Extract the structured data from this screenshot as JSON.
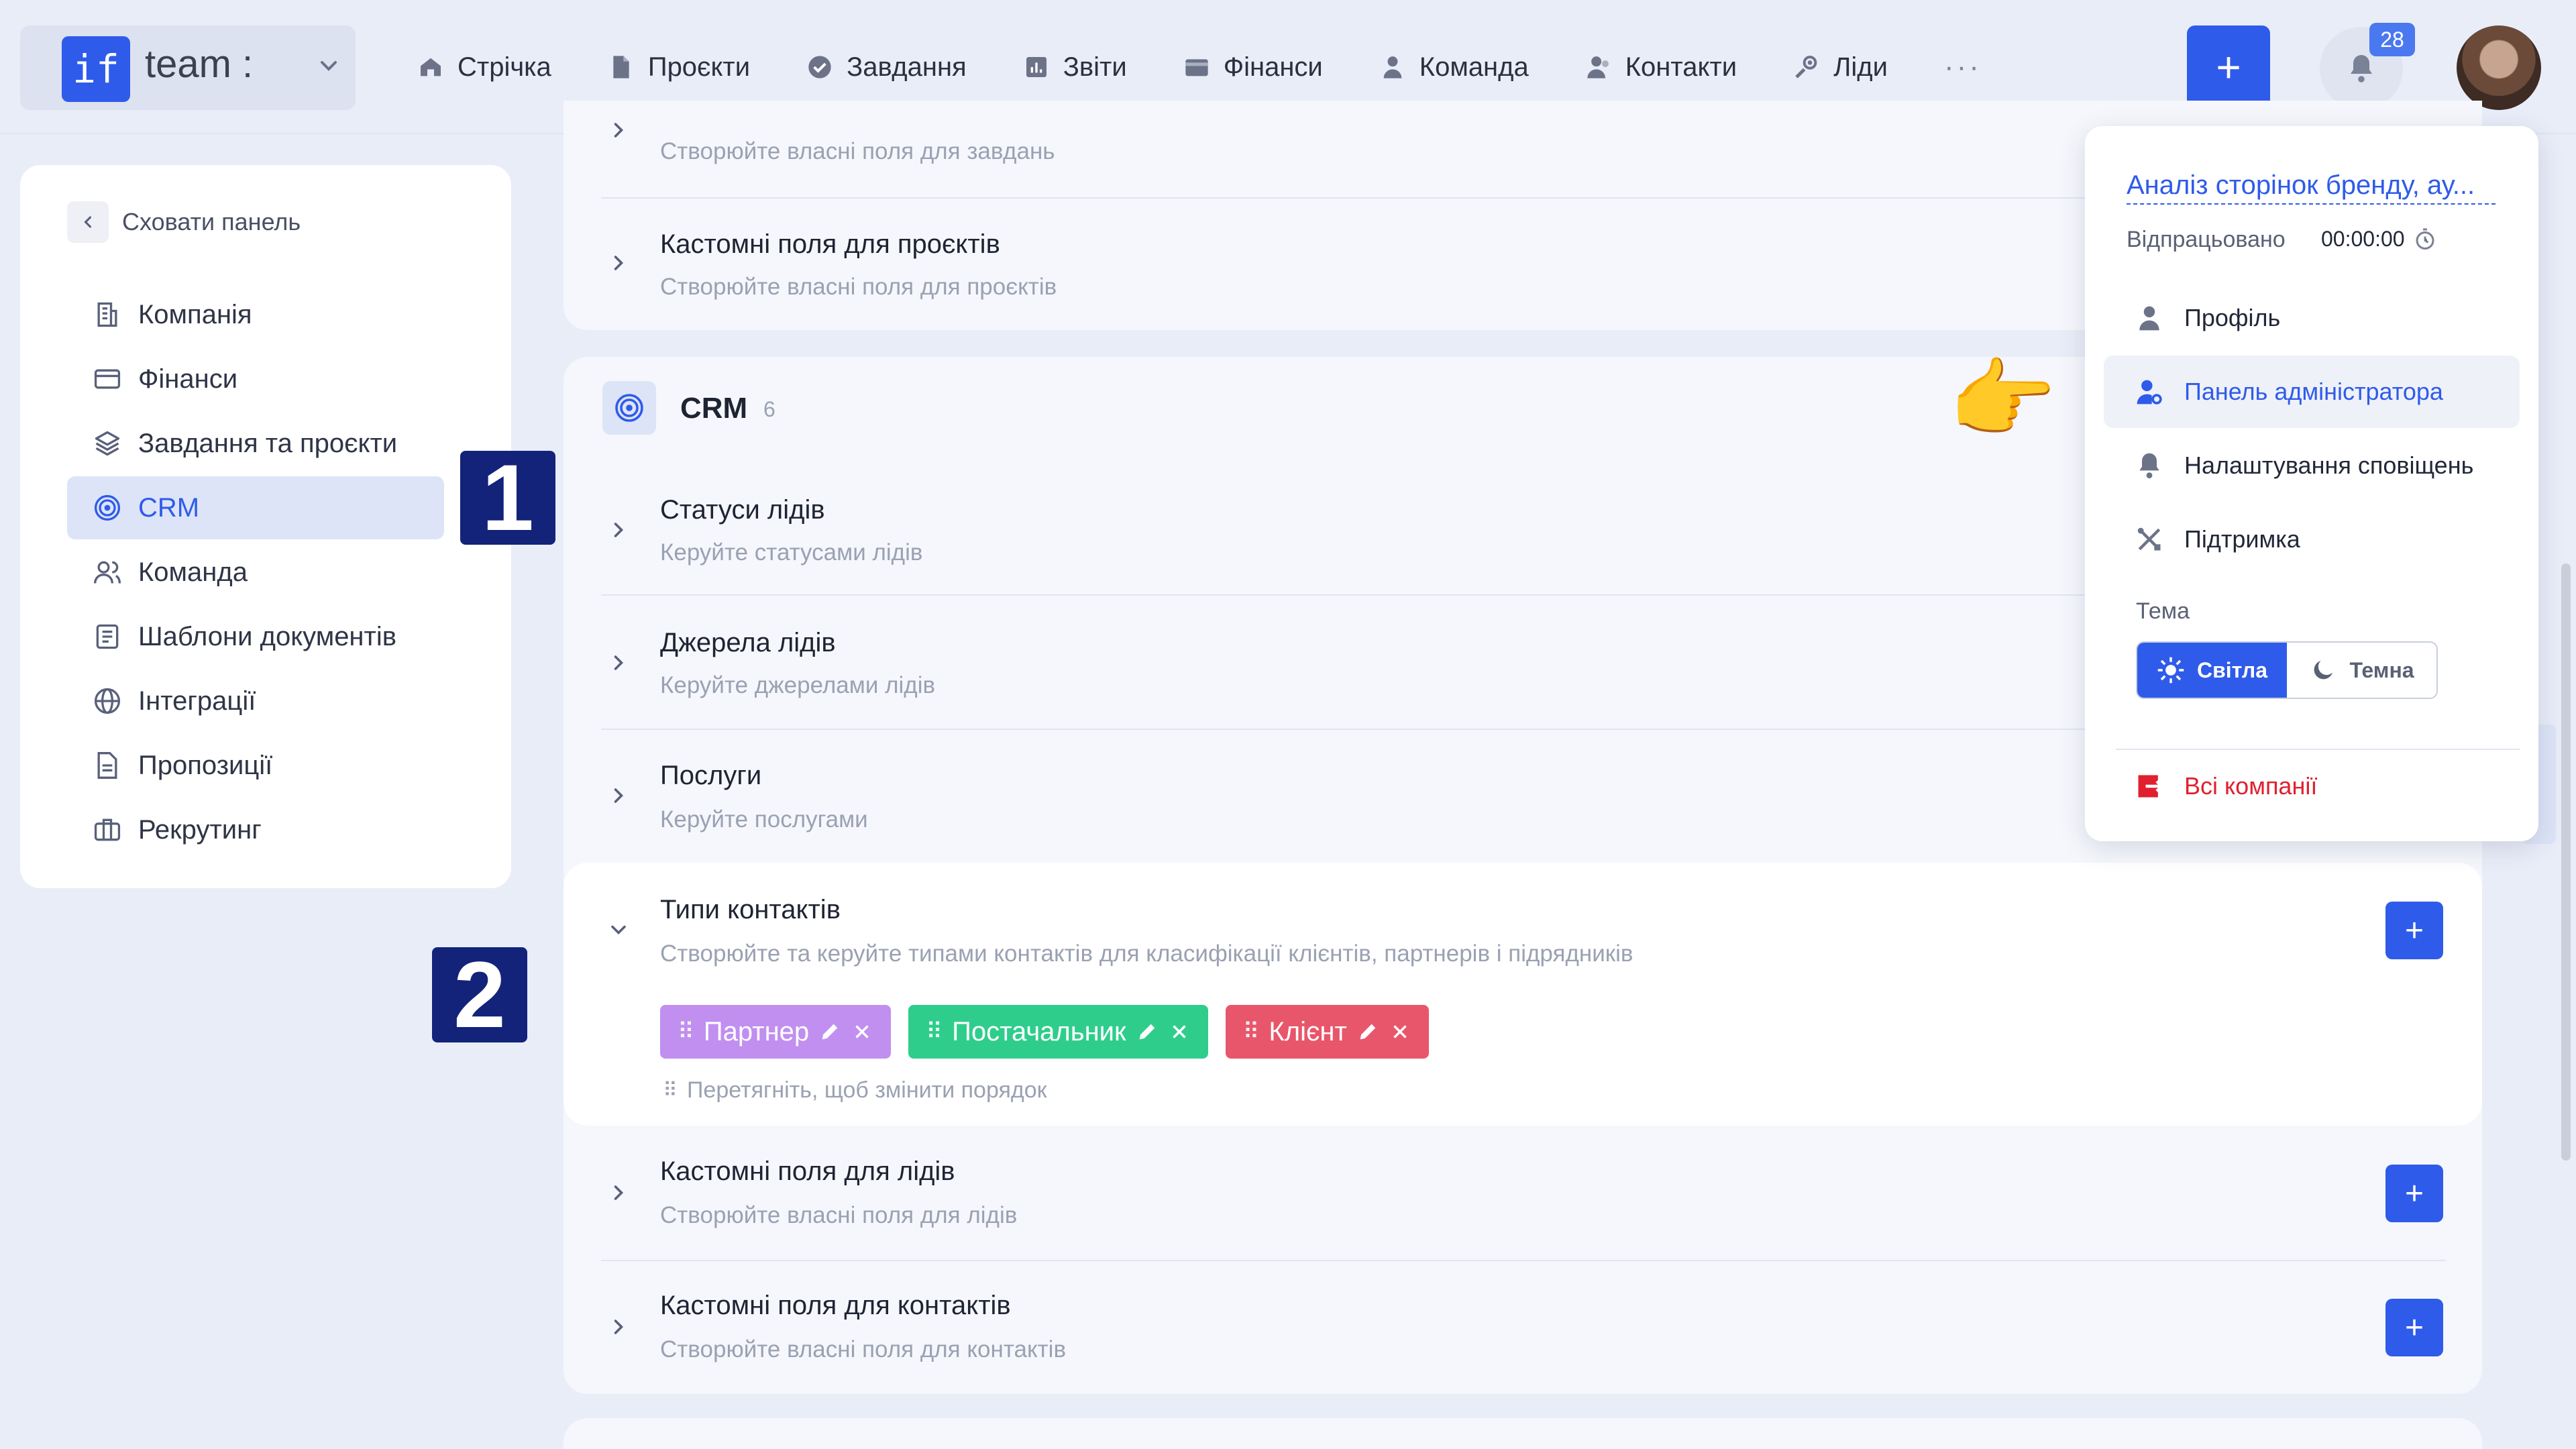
{
  "logo": {
    "mark": "if",
    "name": "team :"
  },
  "nav": [
    {
      "label": "Стрічка",
      "icon": "home-icon"
    },
    {
      "label": "Проєкти",
      "icon": "document-icon"
    },
    {
      "label": "Завдання",
      "icon": "check-circle-icon"
    },
    {
      "label": "Звіти",
      "icon": "chart-icon"
    },
    {
      "label": "Фінанси",
      "icon": "wallet-icon"
    },
    {
      "label": "Команда",
      "icon": "user-icon"
    },
    {
      "label": "Контакти",
      "icon": "contacts-icon"
    },
    {
      "label": "Ліди",
      "icon": "leads-icon"
    }
  ],
  "nav_more": "···",
  "header": {
    "plus_label": "+",
    "notifications_count": "28"
  },
  "sidebar": {
    "hide_label": "Сховати панель",
    "items": [
      {
        "label": "Компанія",
        "icon": "company-icon"
      },
      {
        "label": "Фінанси",
        "icon": "card-icon"
      },
      {
        "label": "Завдання та проєкти",
        "icon": "layers-icon"
      },
      {
        "label": "CRM",
        "icon": "target-icon",
        "active": true
      },
      {
        "label": "Команда",
        "icon": "team-icon"
      },
      {
        "label": "Шаблони документів",
        "icon": "template-icon"
      },
      {
        "label": "Інтеграції",
        "icon": "globe-icon"
      },
      {
        "label": "Пропозиції",
        "icon": "proposal-icon"
      },
      {
        "label": "Рекрутинг",
        "icon": "briefcase-icon"
      }
    ]
  },
  "badges": {
    "one": "1",
    "two": "2"
  },
  "top_card": {
    "partial_sub": "Створюйте власні поля для завдань",
    "project_fields_title": "Кастомні поля для проєктів",
    "project_fields_sub": "Створюйте власні поля для проєктів"
  },
  "crm": {
    "title": "CRM",
    "count": "6",
    "rows": [
      {
        "title": "Статуси лідів",
        "sub": "Керуйте статусами лідів"
      },
      {
        "title": "Джерела лідів",
        "sub": "Керуйте джерелами лідів"
      },
      {
        "title": "Послуги",
        "sub": "Керуйте послугами"
      }
    ],
    "contact_types": {
      "title": "Типи контактів",
      "sub": "Створюйте та керуйте типами контактів для класифікації клієнтів, партнерів і підрядників",
      "chips": [
        {
          "label": "Партнер",
          "color": "#c08ff0"
        },
        {
          "label": "Постачальник",
          "color": "#2fcd8c"
        },
        {
          "label": "Клієнт",
          "color": "#e8566b"
        }
      ],
      "drag_hint": "Перетягніть, щоб змінити порядок"
    },
    "lead_fields": {
      "title": "Кастомні поля для лідів",
      "sub": "Створюйте власні поля для лідів"
    },
    "contact_fields": {
      "title": "Кастомні поля для контактів",
      "sub": "Створюйте власні поля для контактів"
    }
  },
  "menu": {
    "task_link": "Аналіз сторінок бренду, ау...",
    "worked_label": "Відпрацьовано",
    "worked_time": "00:00:00",
    "items": [
      {
        "label": "Профіль",
        "icon": "user-icon"
      },
      {
        "label": "Панель адміністратора",
        "icon": "admin-icon"
      },
      {
        "label": "Налаштування сповіщень",
        "icon": "bell-icon"
      },
      {
        "label": "Підтримка",
        "icon": "tools-icon"
      }
    ],
    "theme_label": "Тема",
    "theme_light": "Світла",
    "theme_dark": "Темна",
    "all_companies": "Всі компанії"
  },
  "pointer_emoji": "👉",
  "colors": {
    "accent": "#2f5bea",
    "danger": "#e0202e",
    "badge_navy": "#13237a"
  }
}
